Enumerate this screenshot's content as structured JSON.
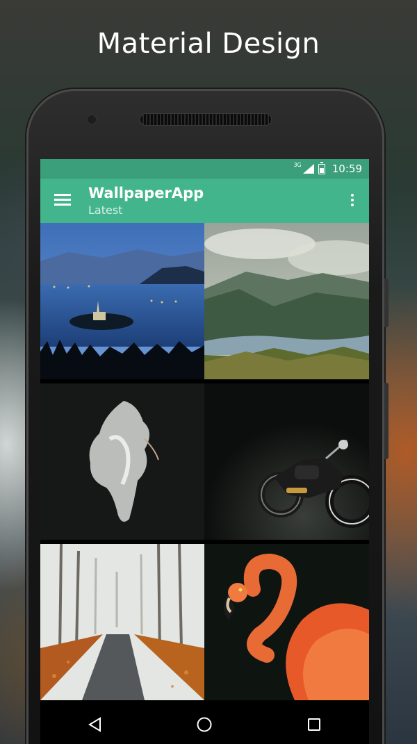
{
  "headline": "Material Design",
  "status_bar": {
    "network": "3G",
    "time": "10:59"
  },
  "app_bar": {
    "title": "WallpaperApp",
    "subtitle": "Latest",
    "menu_icon": "hamburger-menu-icon",
    "overflow_icon": "more-vert-icon"
  },
  "wallpapers": [
    {
      "subject": "lake-island-church-at-dusk"
    },
    {
      "subject": "mountain-valley-lake"
    },
    {
      "subject": "smoke-figure-dark"
    },
    {
      "subject": "motorcycle-dark"
    },
    {
      "subject": "foggy-forest-road-autumn"
    },
    {
      "subject": "flamingo"
    }
  ],
  "nav_bar": {
    "back_icon": "back-triangle-icon",
    "home_icon": "home-circle-icon",
    "recents_icon": "recents-square-icon"
  },
  "colors": {
    "status_bar": "#3c9f7c",
    "app_bar": "#43b58c"
  }
}
